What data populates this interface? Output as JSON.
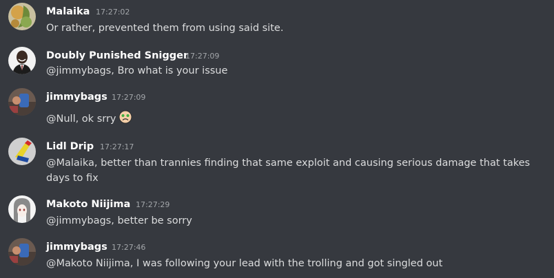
{
  "messages": [
    {
      "username": "Malaika",
      "timestamp": "17:27:02",
      "text": "Or rather, prevented them from using said site."
    },
    {
      "username": "Doubly Punished Snigger",
      "timestamp": "17:27:09",
      "text": "@jimmybags, Bro what is your issue"
    },
    {
      "username": "jimmybags",
      "timestamp": "17:27:09",
      "text": "@Null, ok srry",
      "emoji": "worried-face"
    },
    {
      "username": "Lidl Drip",
      "timestamp": "17:27:17",
      "text_line1": "@Malaika, better than trannies finding that same exploit and causing serious damage that takes",
      "text_line2": "days to fix"
    },
    {
      "username": "Makoto Niijima",
      "timestamp": "17:27:29",
      "text": "@jimmybags, better be sorry"
    },
    {
      "username": "jimmybags",
      "timestamp": "17:27:46",
      "text": "@Makoto Niijima, I was following your lead with the trolling and got singled out"
    }
  ],
  "colors": {
    "background": "#36393f",
    "username": "#ffffff",
    "timestamp": "#a3a6aa",
    "message_text": "#dcddde"
  }
}
